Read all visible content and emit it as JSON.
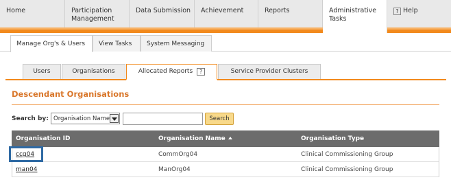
{
  "top_nav": {
    "items": [
      {
        "label": "Home"
      },
      {
        "label": "Participation\nManagement"
      },
      {
        "label": "Data Submission"
      },
      {
        "label": "Achievement"
      },
      {
        "label": "Reports"
      },
      {
        "label": "Administrative\nTasks"
      },
      {
        "label": "Help",
        "icon": "help-box-icon"
      }
    ],
    "active": "Administrative Tasks"
  },
  "sub_nav": {
    "items": [
      {
        "label": "Manage Org's & Users"
      },
      {
        "label": "View Tasks"
      },
      {
        "label": "System Messaging"
      }
    ],
    "active": "Manage Org's & Users"
  },
  "tabs": {
    "items": [
      {
        "label": "Users"
      },
      {
        "label": "Organisations"
      },
      {
        "label": "Allocated Reports",
        "help_icon": "?"
      },
      {
        "label": "Service Provider Clusters"
      }
    ],
    "active": "Allocated Reports"
  },
  "section": {
    "title": "Descendant Organisations"
  },
  "search": {
    "label": "Search by:",
    "select_value": "Organisation Name",
    "input_value": "",
    "button_label": "Search"
  },
  "table": {
    "columns": [
      "Organisation ID",
      "Organisation Name",
      "Organisation Type"
    ],
    "sorted_column": "Organisation Name",
    "rows": [
      {
        "id": "ccg04",
        "name": "CommOrg04",
        "type": "Clinical Commissioning Group"
      },
      {
        "id": "man04",
        "name": "ManOrg04",
        "type": "Clinical Commissioning Group"
      }
    ]
  },
  "colors": {
    "accent": "#f28a1d",
    "section_title": "#d9772b",
    "header_bg": "#6c6c6c",
    "highlight": "#2f6aa4",
    "search_button": "#f8d98a"
  }
}
